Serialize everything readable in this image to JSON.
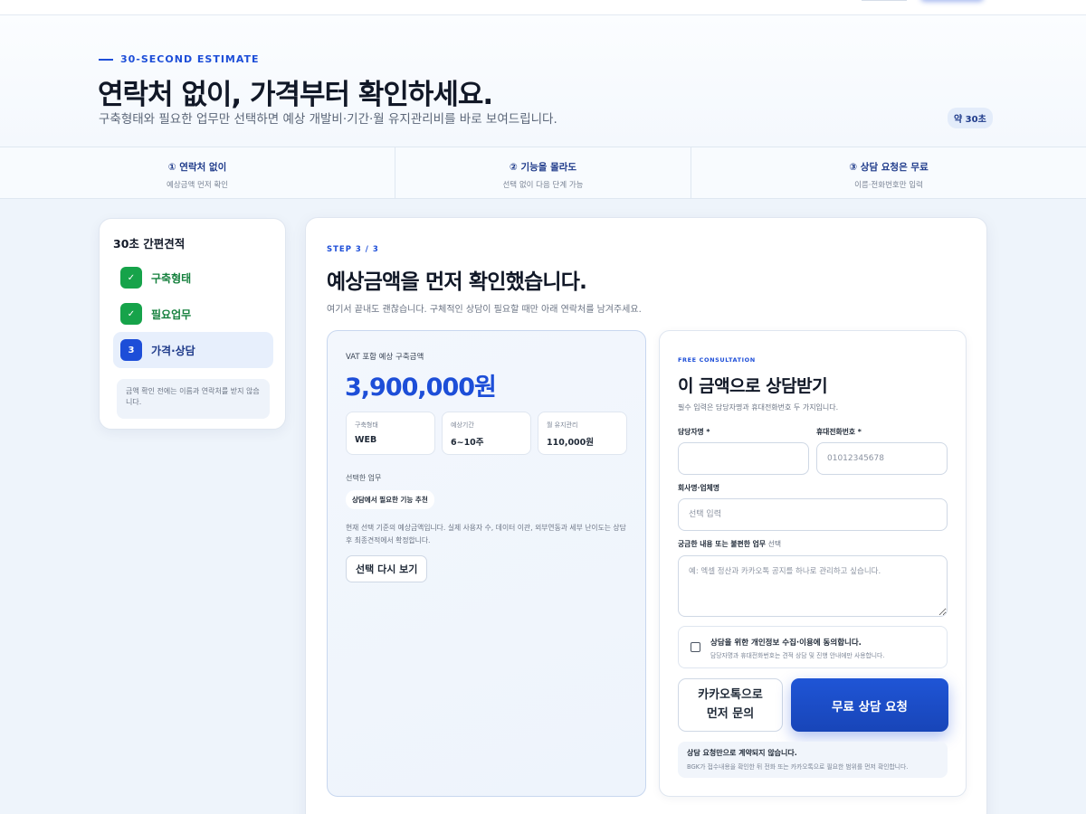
{
  "hero": {
    "eyebrow": "30-SECOND ESTIMATE",
    "title": "연락처 없이, 가격부터 확인하세요.",
    "subtitle": "구축형태와 필요한 업무만 선택하면 예상 개발비·기간·월 유지관리비를 바로 보여드립니다.",
    "time_badge": "약 30초"
  },
  "steps_bar": [
    {
      "title": "① 연락처 없이",
      "sub": "예상금액 먼저 확인"
    },
    {
      "title": "② 기능을 몰라도",
      "sub": "선택 없이 다음 단계 가능"
    },
    {
      "title": "③ 상담 요청은 무료",
      "sub": "이름·전화번호만 입력"
    }
  ],
  "sidebar": {
    "title": "30초 간편견적",
    "steps": [
      {
        "badge": "✓",
        "label": "구축형태"
      },
      {
        "badge": "✓",
        "label": "필요업무"
      },
      {
        "badge": "3",
        "label": "가격·상담"
      }
    ],
    "note": "금액 확인 전에는 이름과 연락처를 받지 않습니다."
  },
  "main": {
    "step_label": "STEP 3 / 3",
    "title": "예상금액을 먼저 확인했습니다.",
    "subtitle": "여기서 끝내도 괜찮습니다. 구체적인 상담이 필요할 때만 아래 연락처를 남겨주세요."
  },
  "estimate": {
    "label": "VAT 포함 예상 구축금액",
    "amount": "3,900,000원",
    "info": [
      {
        "key": "구축형태",
        "value": "WEB"
      },
      {
        "key": "예상기간",
        "value": "6~10주"
      },
      {
        "key": "월 유지관리",
        "value": "110,000원"
      }
    ],
    "selected_label": "선택한 업무",
    "chip": "상담에서 필요한 기능 추천",
    "note": "현재 선택 기준의 예상금액입니다. 실제 사용자 수, 데이터 이관, 외부연동과 세부 난이도는 상담 후 최종견적에서 확정합니다.",
    "reselect_button": "선택 다시 보기"
  },
  "form": {
    "eyebrow": "FREE CONSULTATION",
    "title": "이 금액으로 상담받기",
    "subtitle": "필수 입력은 담당자명과 휴대전화번호 두 가지입니다.",
    "name_label": "담당자명 *",
    "name_value": "",
    "phone_label": "휴대전화번호 *",
    "phone_placeholder": "01012345678",
    "company_label": "회사명·업체명",
    "company_placeholder": "선택 입력",
    "question_label": "궁금한 내용 또는 불편한 업무",
    "question_optional": "선택",
    "question_placeholder": "예: 엑셀 정산과 카카오톡 공지를 하나로 관리하고 싶습니다.",
    "consent_title": "상담을 위한 개인정보 수집·이용에 동의합니다.",
    "consent_sub": "담당자명과 휴대전화번호는 견적 상담 및 진행 안내에만 사용합니다.",
    "kakao_button_line1": "카카오톡으로",
    "kakao_button_line2": "먼저 문의",
    "submit_button": "무료 상담 요청",
    "notice_title": "상담 요청만으로 계약되지 않습니다.",
    "notice_sub": "BGK가 접수내용을 확인한 뒤 전화 또는 카카오톡으로 필요한 범위를 먼저 확인합니다."
  },
  "colors": {
    "accent": "#1d4ed8",
    "success": "#16a34a",
    "background": "#eef4fb"
  }
}
